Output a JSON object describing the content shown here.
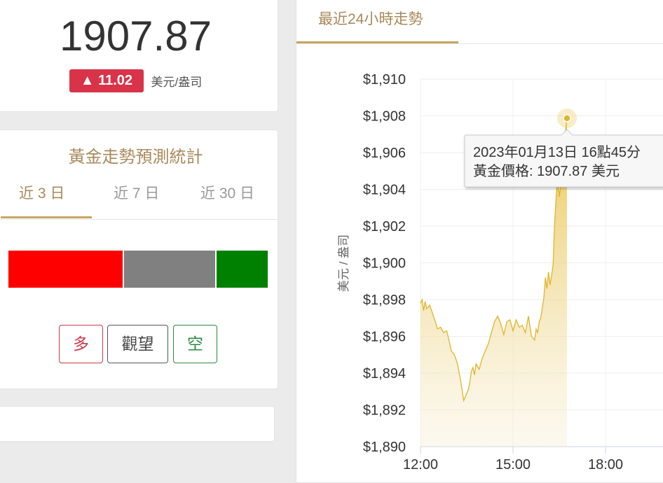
{
  "price": {
    "value": "1907.87",
    "change": "▲ 11.02",
    "unit": "美元/盎司"
  },
  "forecast": {
    "title": "黃金走勢預測統計",
    "tabs": [
      "近 3 日",
      "近 7 日",
      "近 30 日"
    ],
    "active_tab": 0,
    "distribution": {
      "long_fraction": 0.44,
      "neutral_fraction": 0.35,
      "short_fraction": 0.2
    },
    "buttons": {
      "long": "多",
      "watch": "觀望",
      "short": "空"
    },
    "colors": {
      "long": "#ff0000",
      "neutral": "#808080",
      "short": "#008000"
    }
  },
  "chart_section": {
    "tab_label": "最近24小時走勢"
  },
  "chart_data": {
    "type": "area",
    "ylabel": "美元 / 盎司",
    "y_ticks": [
      "$1,910",
      "$1,908",
      "$1,906",
      "$1,904",
      "$1,902",
      "$1,900",
      "$1,898",
      "$1,896",
      "$1,894",
      "$1,892",
      "$1,890"
    ],
    "x_ticks": [
      "12:00",
      "15:00",
      "18:00"
    ],
    "ylim": [
      1890,
      1910
    ],
    "x_hour_range": [
      12,
      20
    ],
    "line_color": "#e0b52a",
    "series": [
      {
        "x": [
          12.0,
          12.05,
          12.1,
          12.15,
          12.2,
          12.3,
          12.4,
          12.5,
          12.55,
          12.65,
          12.75,
          12.85,
          12.95,
          13.0,
          13.1,
          13.2,
          13.3,
          13.4,
          13.5,
          13.55,
          13.6,
          13.65,
          13.7,
          13.75,
          13.8,
          13.9,
          14.0,
          14.1,
          14.2,
          14.3,
          14.4,
          14.5,
          14.6,
          14.7,
          14.8,
          14.9,
          15.0,
          15.1,
          15.2,
          15.3,
          15.4,
          15.5,
          15.6,
          15.7,
          15.75,
          15.8,
          15.85,
          15.9,
          16.0,
          16.05,
          16.1,
          16.15,
          16.2,
          16.25,
          16.3,
          16.35,
          16.4,
          16.45,
          16.5,
          16.55,
          16.6,
          16.65,
          16.7,
          16.75
        ],
        "y": [
          1897.8,
          1898.0,
          1897.4,
          1897.9,
          1897.5,
          1897.7,
          1897.2,
          1896.7,
          1896.4,
          1896.5,
          1896.2,
          1896.3,
          1895.6,
          1895.2,
          1895.0,
          1894.5,
          1893.6,
          1892.5,
          1892.9,
          1893.1,
          1893.5,
          1894.1,
          1894.3,
          1893.9,
          1894.5,
          1894.2,
          1894.8,
          1895.2,
          1895.6,
          1896.2,
          1896.8,
          1897.1,
          1896.7,
          1896.1,
          1896.8,
          1896.9,
          1896.3,
          1896.9,
          1896.5,
          1896.6,
          1896.2,
          1897.1,
          1896.0,
          1895.8,
          1896.4,
          1896.2,
          1896.8,
          1897.0,
          1898.1,
          1899.2,
          1898.6,
          1899.5,
          1898.8,
          1899.3,
          1899.9,
          1902.2,
          1903.6,
          1904.8,
          1903.6,
          1904.2,
          1904.8,
          1905.6,
          1907.1,
          1907.87
        ]
      }
    ],
    "tooltip": {
      "line1": "2023年01月13日 16點45分",
      "line2": "黃金價格: 1907.87 美元"
    }
  }
}
